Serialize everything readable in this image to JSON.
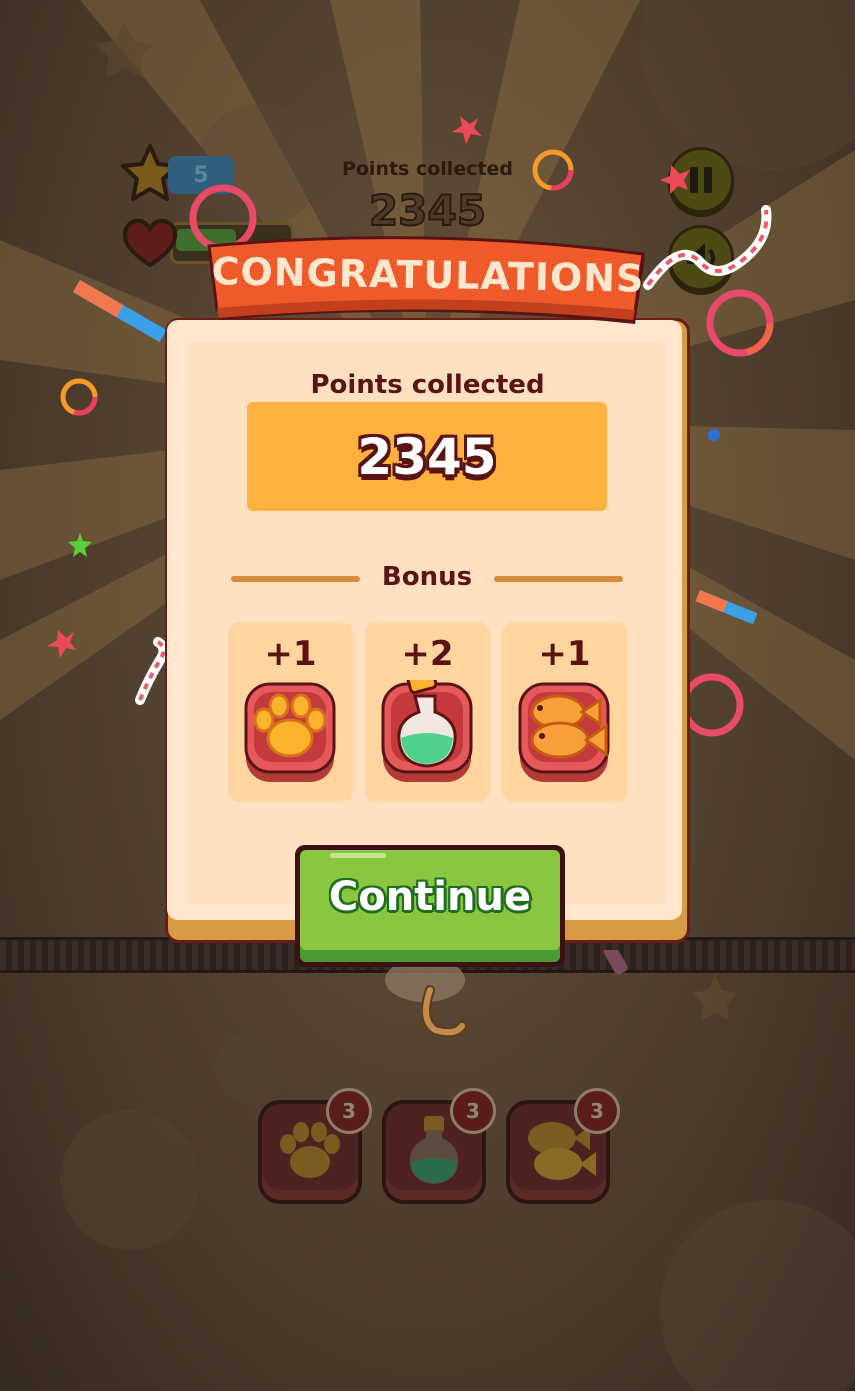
{
  "hud": {
    "level": "5",
    "points_label": "Points collected",
    "points_value": "2345"
  },
  "modal": {
    "banner": "CONGRATULATIONS",
    "points_label": "Points collected",
    "points_value": "2345",
    "bonus_title": "Bonus",
    "bonus_items": [
      {
        "amount": "+1",
        "icon": "paw-icon"
      },
      {
        "amount": "+2",
        "icon": "potion-icon"
      },
      {
        "amount": "+1",
        "icon": "fish-icon"
      }
    ],
    "continue_label": "Continue"
  },
  "boosters": [
    {
      "icon": "paw-icon",
      "count": "3"
    },
    {
      "icon": "potion-icon",
      "count": "3"
    },
    {
      "icon": "fish-icon",
      "count": "3"
    }
  ],
  "colors": {
    "banner": "#ee5a2a",
    "points_box": "#fdb240",
    "continue": "#8bc640",
    "text_dark": "#5a1415"
  }
}
